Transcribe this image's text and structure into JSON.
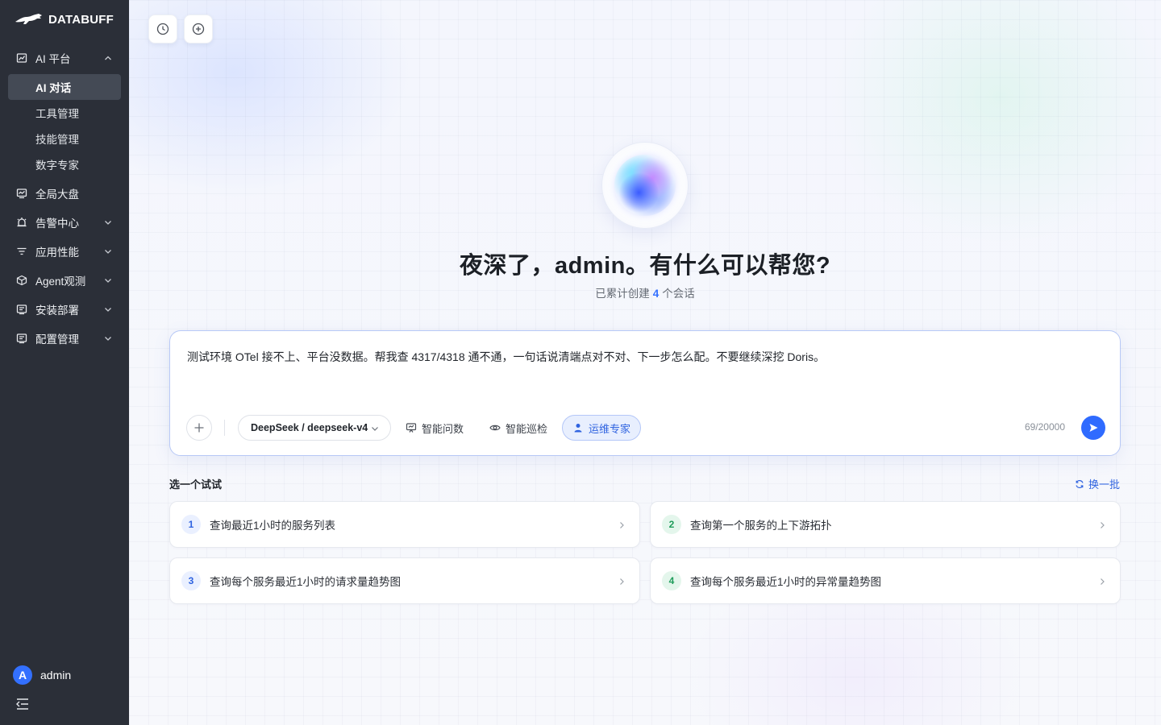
{
  "brand": {
    "name": "DATABUFF"
  },
  "sidebar": {
    "groups": [
      {
        "label": "AI 平台",
        "icon": "ai-chart-icon",
        "expanded": true,
        "items": [
          {
            "label": "AI 对话",
            "active": true
          },
          {
            "label": "工具管理"
          },
          {
            "label": "技能管理"
          },
          {
            "label": "数字专家"
          }
        ]
      },
      {
        "label": "全局大盘",
        "icon": "dashboard-icon"
      },
      {
        "label": "告警中心",
        "icon": "alarm-icon"
      },
      {
        "label": "应用性能",
        "icon": "filter-lines-icon"
      },
      {
        "label": "Agent观测",
        "icon": "cube-icon"
      },
      {
        "label": "安装部署",
        "icon": "doc-list-icon"
      },
      {
        "label": "配置管理",
        "icon": "settings-doc-icon"
      }
    ],
    "user": {
      "avatar_letter": "A",
      "name": "admin"
    }
  },
  "toolbar": {
    "history_icon": "clock-icon",
    "new_chat_icon": "plus-circle-icon"
  },
  "hero": {
    "greeting": "夜深了，admin。有什么可以帮您?",
    "session_prefix": "已累计创建",
    "session_count": "4",
    "session_suffix": "个会话"
  },
  "composer": {
    "value": "测试环境 OTel 接不上、平台没数据。帮我查 4317/4318 通不通，一句话说清端点对不对、下一步怎么配。不要继续深挖 Doris。",
    "model": "DeepSeek / deepseek-v4",
    "chips": [
      {
        "label": "智能问数",
        "icon": "chart-board-icon",
        "active": false
      },
      {
        "label": "智能巡检",
        "icon": "eye-icon",
        "active": false
      },
      {
        "label": "运维专家",
        "icon": "user-icon",
        "active": true
      }
    ],
    "counter": "69/20000"
  },
  "suggestions": {
    "title": "选一个试试",
    "refresh": "换一批",
    "items": [
      {
        "num": "1",
        "text": "查询最近1小时的服务列表"
      },
      {
        "num": "2",
        "text": "查询第一个服务的上下游拓扑"
      },
      {
        "num": "3",
        "text": "查询每个服务最近1小时的请求量趋势图"
      },
      {
        "num": "4",
        "text": "查询每个服务最近1小时的异常量趋势图"
      }
    ]
  },
  "colors": {
    "sidebar_bg": "#2b2f38",
    "accent": "#2f6bff",
    "active_item": "#444a55"
  }
}
